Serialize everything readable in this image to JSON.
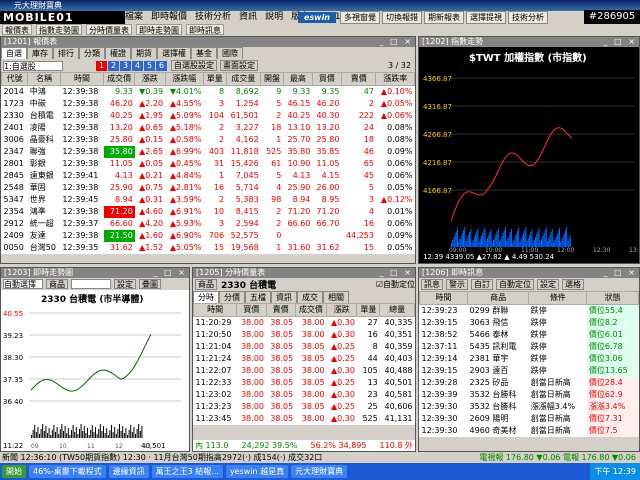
{
  "app": {
    "title": "元大理財寶典",
    "logo": "MOBILE01",
    "stamp": "#286905"
  },
  "menu": [
    "檔案",
    "即時報價",
    "技術分析",
    "資訊",
    "說明",
    "版本 1.3.3195"
  ],
  "top_buttons": [
    "多視窗覺",
    "切換報錯",
    "期新報表",
    "選擇提視",
    "技術分析"
  ],
  "toolbar": [
    "報價表",
    "指數走勢圖",
    "分時價量表",
    "即時走勢圖",
    "即時訊息"
  ],
  "quote": {
    "title": "[1201] 報價表",
    "page": "3 / 32",
    "tabs": [
      "自選",
      "庫存",
      "排行",
      "分類",
      "權證",
      "期貨",
      "選擇權",
      "基金",
      "國際"
    ],
    "select": "1:自選股",
    "numbers": [
      "1",
      "2",
      "3",
      "4",
      "5",
      "6"
    ],
    "btn_custom": "自選股設定",
    "btn_style": "畫面設定",
    "columns": [
      "代號",
      "名稱",
      "時間",
      "成交價",
      "漲跌",
      "漲跌幅",
      "單量",
      "成交量",
      "開盤",
      "最高",
      "買價",
      "賣價",
      "漲跌率"
    ],
    "rows": [
      [
        "2014",
        "中鴻",
        "12:39:38",
        "9.33",
        "▼0.39",
        "▼4.01%",
        "8",
        "8,692",
        "9",
        "9.33",
        "9.35",
        "47",
        "▲0.10%"
      ],
      [
        "1723",
        "中碳",
        "12:39:38",
        "46.20",
        "▲2.20",
        "▲4.55%",
        "3",
        "1,254",
        "5",
        "46.15",
        "46.20",
        "2",
        "▲0.05%"
      ],
      [
        "2330",
        "台積電",
        "12:39:38",
        "40.25",
        "▲1.95",
        "▲5.09%",
        "104",
        "61,501",
        "2",
        "40.25",
        "40.30",
        "222",
        "▲0.06%"
      ],
      [
        "2401",
        "凌陽",
        "12:39:38",
        "13.20",
        "▲0.65",
        "▲5.18%",
        "2",
        "3,227",
        "18",
        "13.10",
        "13.20",
        "24",
        "0.08%"
      ],
      [
        "3006",
        "晶豪科",
        "12:39:38",
        "25.80",
        "▲0.15",
        "▲0.58%",
        "2",
        "4,162",
        "1",
        "25.70",
        "25.80",
        "18",
        "0.08%"
      ],
      [
        "2347",
        "聯強",
        "12:39:38",
        "35.80",
        "▲2.65",
        "▲6.99%",
        "403",
        "11,818",
        "525",
        "35.80",
        "35.85",
        "46",
        "0.09%"
      ],
      [
        "2801",
        "彰銀",
        "12:39:38",
        "11.05",
        "▲0.05",
        "▲0.45%",
        "31",
        "15,426",
        "61",
        "10.90",
        "11.05",
        "65",
        "0.06%"
      ],
      [
        "2845",
        "遠東銀",
        "12:39:41",
        "4.13",
        "▲0.21",
        "▲4.84%",
        "1",
        "7,045",
        "5",
        "4.13",
        "4.15",
        "45",
        "0.06%"
      ],
      [
        "2548",
        "華固",
        "12:39:38",
        "25.90",
        "▲0.75",
        "▲2.81%",
        "16",
        "5,714",
        "4",
        "25.90",
        "26.00",
        "5",
        "0.05%"
      ],
      [
        "5347",
        "世界",
        "12:39:45",
        "8.94",
        "▲0.31",
        "▲3.59%",
        "2",
        "5,383",
        "98",
        "8.94",
        "8.95",
        "3",
        "▲0.12%"
      ],
      [
        "2354",
        "鴻準",
        "12:39:38",
        "71.20",
        "▲4.60",
        "▲6.91%",
        "10",
        "8,415",
        "2",
        "71.20",
        "71.20",
        "4",
        "0.01%"
      ],
      [
        "2912",
        "統一超",
        "12:39:37",
        "66.60",
        "▲4.20",
        "▲5.93%",
        "3",
        "2,594",
        "2",
        "66.60",
        "66.70",
        "16",
        "0.06%"
      ],
      [
        "2409",
        "友達",
        "12:39:38",
        "21.50",
        "▲1.60",
        "▲6.90%",
        "706",
        "52,575",
        "0",
        "",
        "",
        "44,253",
        "0.09%"
      ],
      [
        "0050",
        "台灣50",
        "12:39:35",
        "31.62",
        "▲1.52",
        "▲5.05%",
        "15",
        "19,568",
        "1",
        "31.60",
        "31.62",
        "15",
        "0.05%"
      ]
    ]
  },
  "index": {
    "title": "[1202] 指數走勢",
    "name": "$TWT 加權指數 (市指數)",
    "ticks": [
      "4366.87",
      "4316.87",
      "4266.87",
      "4216.87",
      "4166.87"
    ],
    "time": "12:39",
    "value": "4339.05",
    "change": "▲27.82",
    "pct": "▲ 4.49",
    "vol": "530.24",
    "x_ticks": [
      "09:00",
      "10:00",
      "11:00",
      "12:00",
      "12:30",
      "13:30"
    ],
    "line_color": "#ff3030"
  },
  "trend": {
    "title": "[1203] 即時走勢圖",
    "select": "自動選擇",
    "btn_product": "商品",
    "btn_set": "設定",
    "btn_overlay": "疊圖",
    "name": "2330 台積電 (市半導體)",
    "ticks": [
      "40.55",
      "39.23",
      "38.30",
      "37.35",
      "36.40"
    ],
    "time": "11:22",
    "x_ticks": [
      "09",
      "10",
      "11",
      "12",
      "13"
    ],
    "vol_label": "40,501"
  },
  "ticks_table": {
    "title": "[1205] 分時價量表",
    "product": "商品",
    "name": "2330 台積電",
    "chk": "自動定位",
    "tabs": [
      "分時",
      "分價",
      "五檔",
      "資訊",
      "成交",
      "相關"
    ],
    "columns": [
      "時間",
      "買價",
      "賣價",
      "成交價",
      "漲跌",
      "單量",
      "總量"
    ],
    "rows": [
      [
        "11:20:29",
        "38.00",
        "38.05",
        "38.00",
        "▲0.30",
        "27",
        "40,335"
      ],
      [
        "11:20:50",
        "38.00",
        "38.05",
        "38.00",
        "▲0.30",
        "16",
        "40,351"
      ],
      [
        "11:21:04",
        "38.00",
        "38.05",
        "38.05",
        "▲0.25",
        "8",
        "40,359"
      ],
      [
        "11:21:24",
        "38.00",
        "38.05",
        "38.05",
        "▲0.25",
        "44",
        "40,403"
      ],
      [
        "11:22:07",
        "38.00",
        "38.05",
        "38.00",
        "▲0.30",
        "105",
        "40,488"
      ],
      [
        "11:22:33",
        "38.00",
        "38.05",
        "38.05",
        "▲0.25",
        "13",
        "40,501"
      ],
      [
        "11:23:02",
        "38.00",
        "38.05",
        "38.00",
        "▲0.30",
        "23",
        "40,581"
      ],
      [
        "11:23:23",
        "38.00",
        "38.05",
        "38.05",
        "▲0.25",
        "25",
        "40,606"
      ],
      [
        "11:23:45",
        "38.00",
        "38.05",
        "38.00",
        "▲0.30",
        "525",
        "41,131"
      ]
    ],
    "foot_left": "內 113.0",
    "foot_mid": "24,292 39.5%",
    "foot_right": "56.2% 34,895",
    "foot_out": "110.8 外"
  },
  "news": {
    "title": "[1206] 即時訊息",
    "btns": [
      "訊息",
      "警示",
      "自訂",
      "自動定位",
      "設定",
      "選格"
    ],
    "columns": [
      "時間",
      "商品",
      "條件",
      "狀態"
    ],
    "rows": [
      [
        "12:39:23",
        "0299 群聯",
        "跌停",
        "價位55.4"
      ],
      [
        "12:39:15",
        "3063 飛信",
        "跌停",
        "價位8.2"
      ],
      [
        "12:38:52",
        "5466 泰林",
        "跌停",
        "價位6.01"
      ],
      [
        "12:37:11",
        "5435 訊利電",
        "跌停",
        "價位6.78"
      ],
      [
        "12:39:14",
        "2381 華宇",
        "跌停",
        "價位3.06"
      ],
      [
        "12:39:15",
        "2903 遠百",
        "跌停",
        "價位13.65"
      ],
      [
        "12:39:28",
        "2325 矽品",
        "創當日新高",
        "價位28.4"
      ],
      [
        "12:39:39",
        "3532 台勝科",
        "創當日新高",
        "價位62.9"
      ],
      [
        "12:39:30",
        "3532 台勝科",
        "漲漲幅3.4%",
        "漲漲3.4%"
      ],
      [
        "12:39:30",
        "2609 陽明",
        "創當日新高",
        "價位7.31"
      ],
      [
        "12:39:30",
        "4960 奇美材",
        "創當日新高",
        "價位7.5"
      ]
    ]
  },
  "status": "新聞 12:36:10 (TW50期貨指數) 12:30 ‧ 11月台灣50期指高2972(‧) 成154(‧) 成交32口",
  "status_right": "電視報 176.80 ▼0.06 電報 176.80 ▼0.06",
  "taskbar": [
    "開始",
    "46%-桌靈下載程式",
    "邊緣資訊",
    "萬王之王3 結報...",
    "yeswin 越是真",
    "元大理財寶典"
  ],
  "clock": "下午 12:39"
}
